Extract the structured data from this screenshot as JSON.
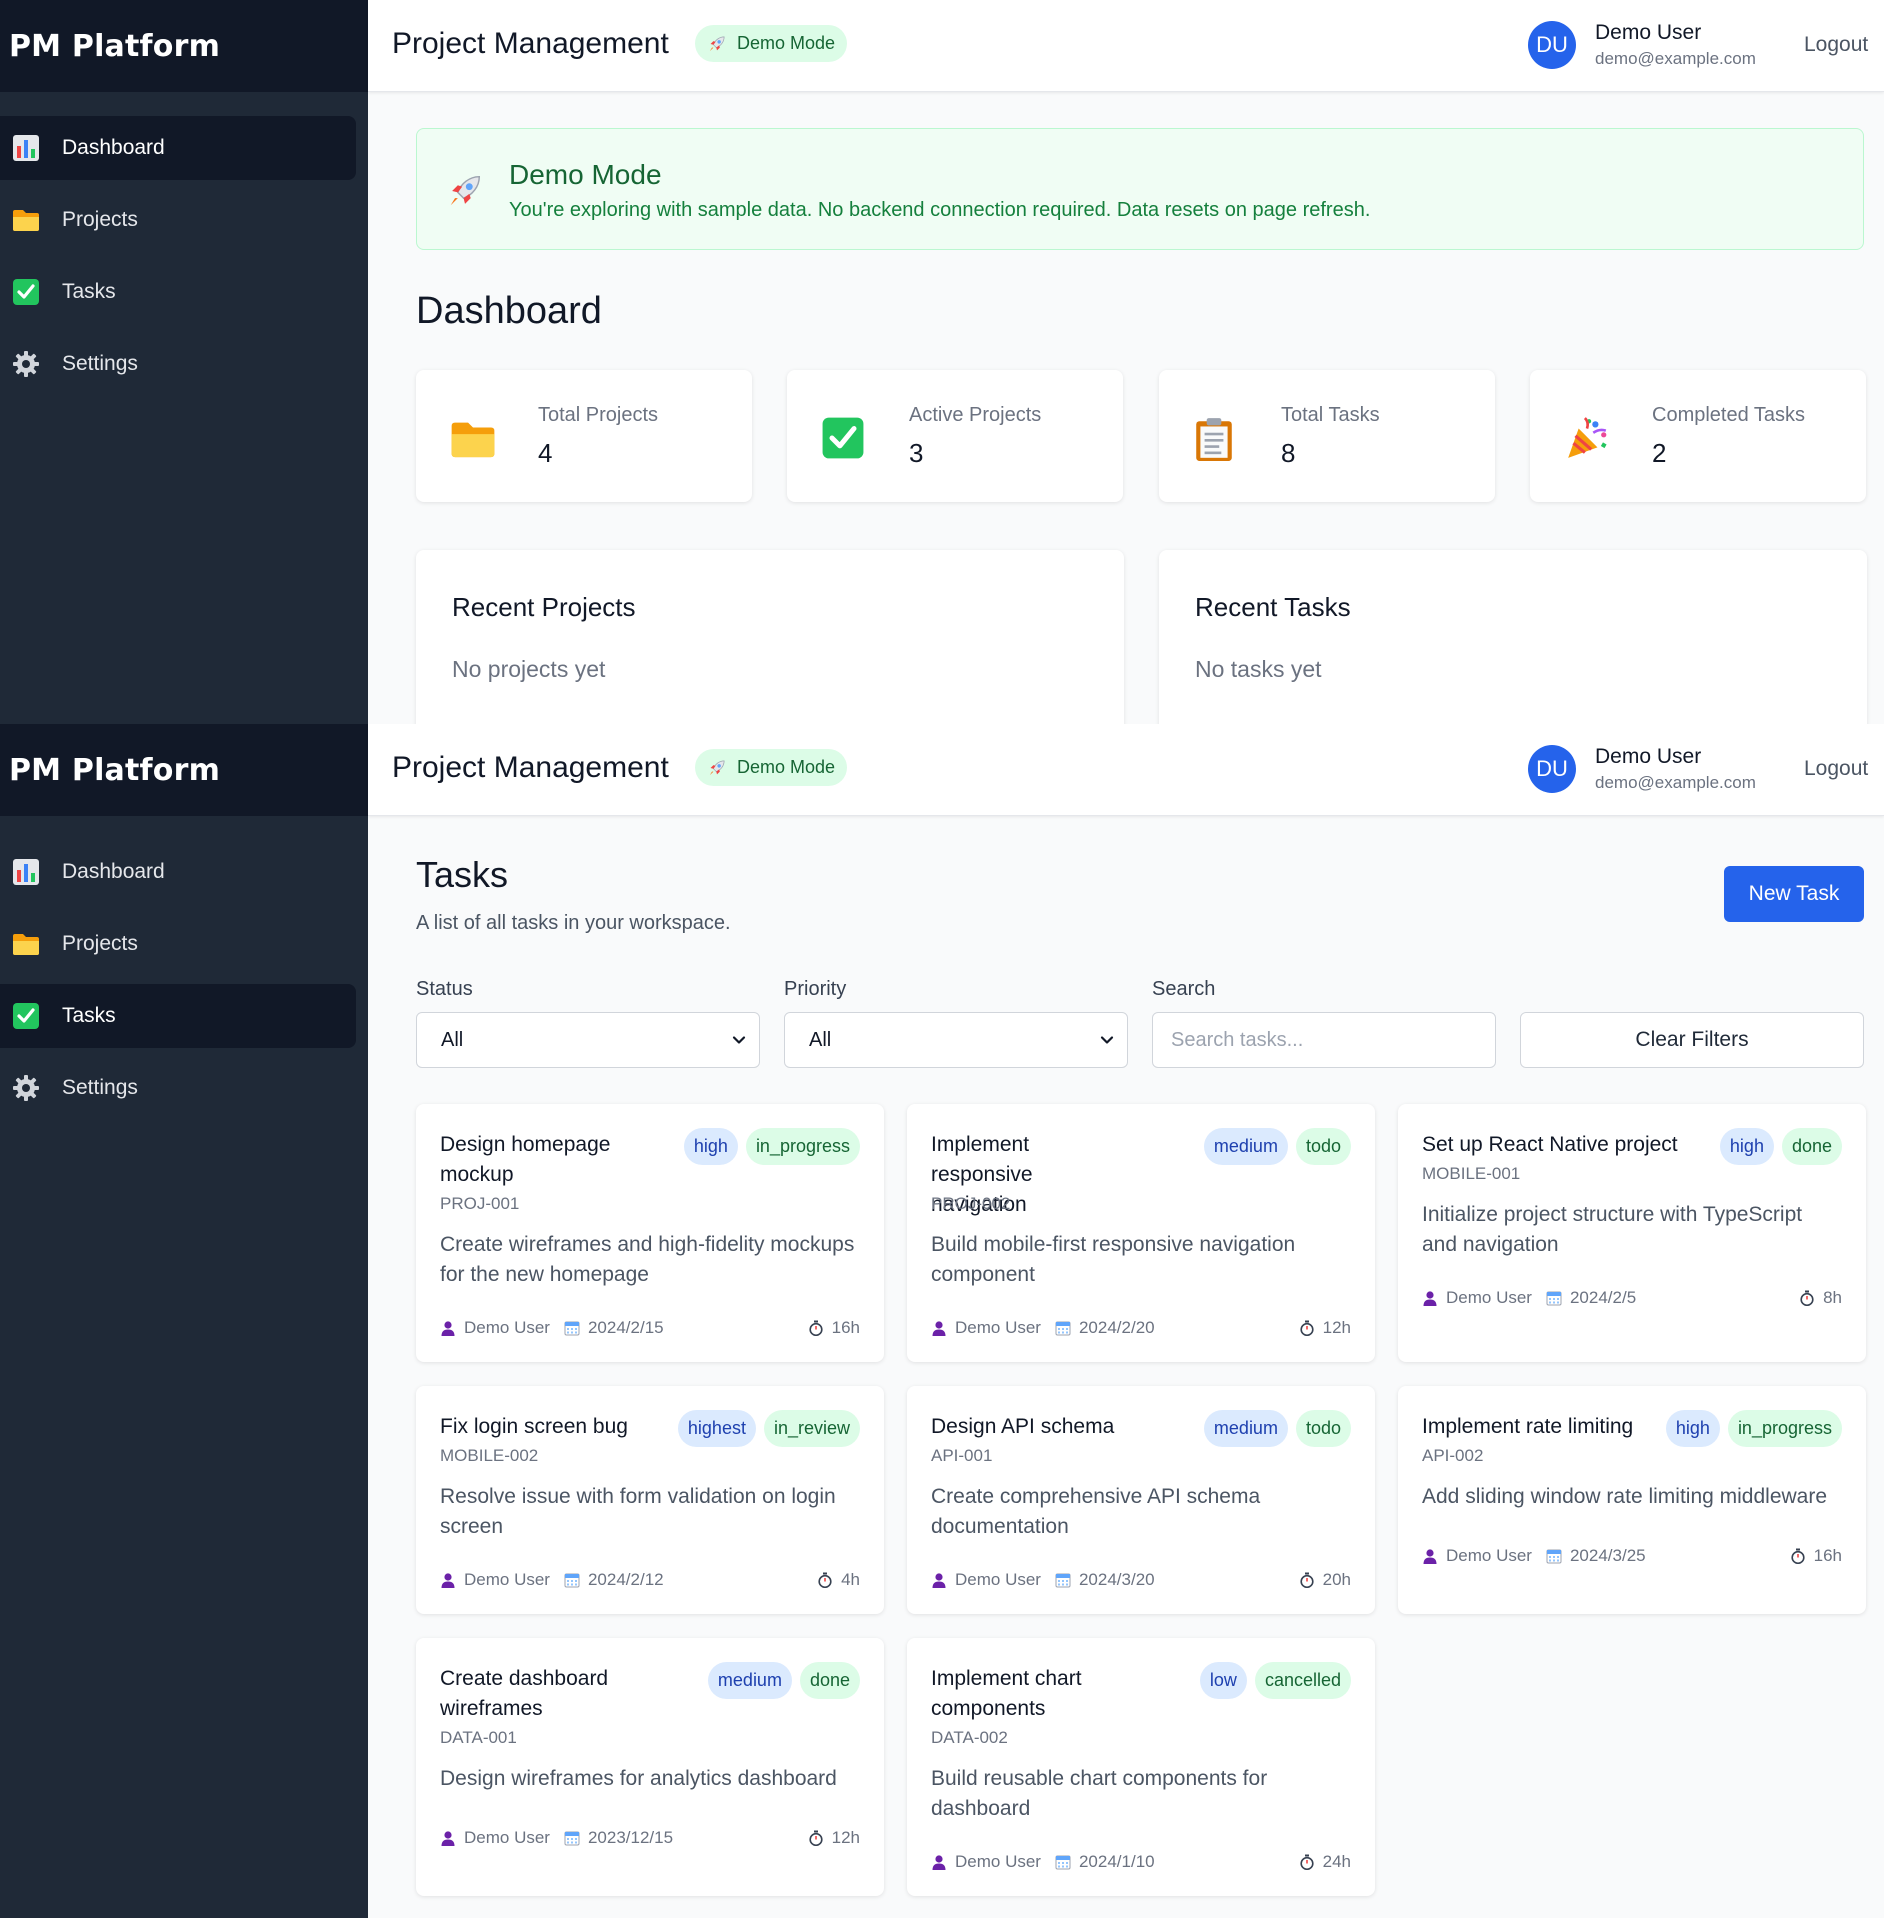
{
  "brand": "PM Platform",
  "nav": [
    {
      "label": "Dashboard",
      "icon": "bar-chart-icon"
    },
    {
      "label": "Projects",
      "icon": "folder-icon"
    },
    {
      "label": "Tasks",
      "icon": "check-box-icon"
    },
    {
      "label": "Settings",
      "icon": "gear-icon"
    }
  ],
  "header": {
    "title": "Project Management",
    "demo_badge": "Demo Mode",
    "avatar_initials": "DU",
    "user_name": "Demo User",
    "user_email": "demo@example.com",
    "logout_label": "Logout"
  },
  "dashboard": {
    "alert_title": "Demo Mode",
    "alert_text": "You're exploring with sample data. No backend connection required. Data resets on page refresh.",
    "title": "Dashboard",
    "stats": [
      {
        "label": "Total Projects",
        "value": "4",
        "icon": "folder-icon"
      },
      {
        "label": "Active Projects",
        "value": "3",
        "icon": "check-box-icon"
      },
      {
        "label": "Total Tasks",
        "value": "8",
        "icon": "clipboard-icon"
      },
      {
        "label": "Completed Tasks",
        "value": "2",
        "icon": "party-popper-icon"
      }
    ],
    "recent_projects_title": "Recent Projects",
    "recent_projects_empty": "No projects yet",
    "recent_tasks_title": "Recent Tasks",
    "recent_tasks_empty": "No tasks yet"
  },
  "tasks_page": {
    "title": "Tasks",
    "subtitle": "A list of all tasks in your workspace.",
    "new_task_label": "New Task",
    "filters": {
      "status_label": "Status",
      "status_value": "All",
      "priority_label": "Priority",
      "priority_value": "All",
      "search_label": "Search",
      "search_placeholder": "Search tasks...",
      "clear_label": "Clear Filters"
    },
    "tasks": [
      {
        "title": "Design homepage mockup",
        "priority": "high",
        "status": "in_progress",
        "key": "PROJ-001",
        "description": "Create wireframes and high-fidelity mockups for the new homepage",
        "assignee": "Demo User",
        "due": "2024/2/15",
        "estimate": "16h"
      },
      {
        "title": "Implement responsive navigation",
        "priority": "medium",
        "status": "todo",
        "key": "PROJ-002",
        "description": "Build mobile-first responsive navigation component",
        "assignee": "Demo User",
        "due": "2024/2/20",
        "estimate": "12h"
      },
      {
        "title": "Set up React Native project",
        "priority": "high",
        "status": "done",
        "key": "MOBILE-001",
        "description": "Initialize project structure with TypeScript and navigation",
        "assignee": "Demo User",
        "due": "2024/2/5",
        "estimate": "8h"
      },
      {
        "title": "Fix login screen bug",
        "priority": "highest",
        "status": "in_review",
        "key": "MOBILE-002",
        "description": "Resolve issue with form validation on login screen",
        "assignee": "Demo User",
        "due": "2024/2/12",
        "estimate": "4h"
      },
      {
        "title": "Design API schema",
        "priority": "medium",
        "status": "todo",
        "key": "API-001",
        "description": "Create comprehensive API schema documentation",
        "assignee": "Demo User",
        "due": "2024/3/20",
        "estimate": "20h"
      },
      {
        "title": "Implement rate limiting",
        "priority": "high",
        "status": "in_progress",
        "key": "API-002",
        "description": "Add sliding window rate limiting middleware",
        "assignee": "Demo User",
        "due": "2024/3/25",
        "estimate": "16h"
      },
      {
        "title": "Create dashboard wireframes",
        "priority": "medium",
        "status": "done",
        "key": "DATA-001",
        "description": "Design wireframes for analytics dashboard",
        "assignee": "Demo User",
        "due": "2023/12/15",
        "estimate": "12h"
      },
      {
        "title": "Implement chart components",
        "priority": "low",
        "status": "cancelled",
        "key": "DATA-002",
        "description": "Build reusable chart components for dashboard",
        "assignee": "Demo User",
        "due": "2024/1/10",
        "estimate": "24h"
      }
    ]
  }
}
